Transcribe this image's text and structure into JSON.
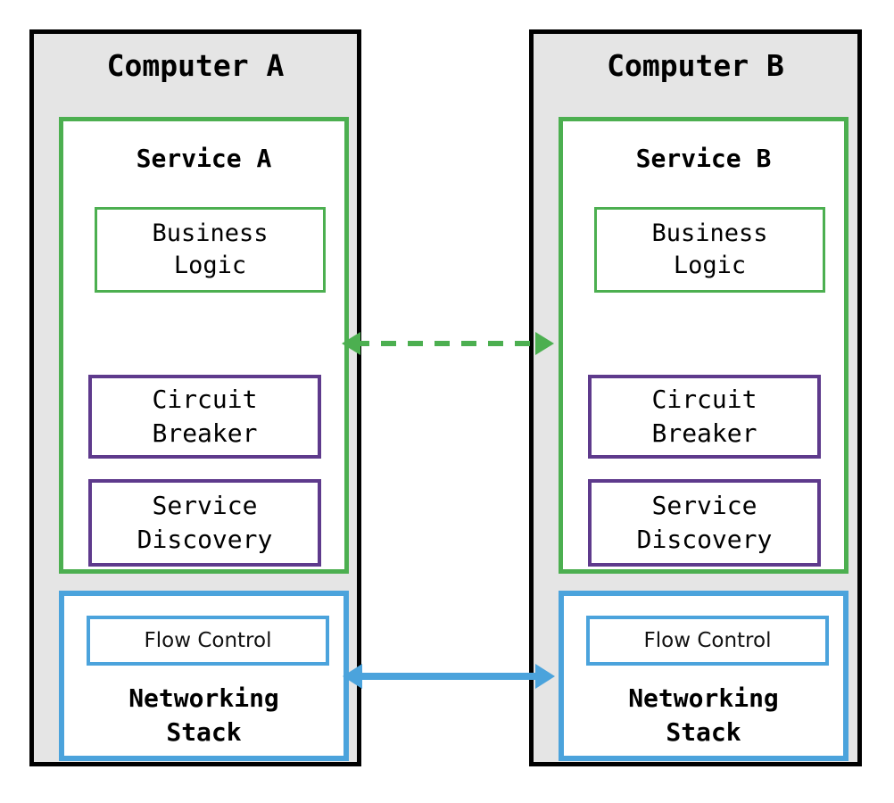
{
  "diagram": {
    "title_hidden": "",
    "colors": {
      "border_black": "#000000",
      "computer_fill": "#e5e5e5",
      "service_green": "#4caf50",
      "purple": "#5e3a8c",
      "network_blue": "#4ba3dc",
      "box_fill": "#ffffff",
      "page_background": "#ffffff"
    },
    "computers": [
      {
        "id": "computer-a",
        "title": "Computer A",
        "service": {
          "title": "Service A",
          "business_logic": "Business\nLogic",
          "circuit_breaker": "Circuit\nBreaker",
          "service_discovery": "Service\nDiscovery"
        },
        "networking": {
          "flow_control": "Flow Control",
          "label": "Networking\nStack"
        }
      },
      {
        "id": "computer-b",
        "title": "Computer B",
        "service": {
          "title": "Service B",
          "business_logic": "Business\nLogic",
          "circuit_breaker": "Circuit\nBreaker",
          "service_discovery": "Service\nDiscovery"
        },
        "networking": {
          "flow_control": "Flow Control",
          "label": "Networking\nStack"
        }
      }
    ],
    "connections": [
      {
        "id": "service-link",
        "style": "dashed",
        "color": "#4caf50",
        "direction": "bidirectional",
        "label": "",
        "from": "Service A",
        "to": "Service B"
      },
      {
        "id": "network-link",
        "style": "solid",
        "color": "#4ba3dc",
        "direction": "bidirectional",
        "label": "",
        "from": "Networking Stack A",
        "to": "Networking Stack B"
      }
    ]
  }
}
